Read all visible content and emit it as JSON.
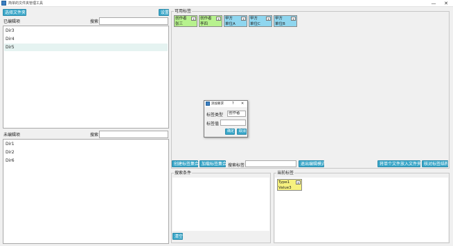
{
  "window": {
    "title": "简单的文件夹管理工具",
    "minimize": "—",
    "close": "✕"
  },
  "left": {
    "select_folder": "选择文件夹",
    "settings": "设置",
    "indexed_label": "已编辑项",
    "search_label": "搜索",
    "indexed_items": [
      "Dir3",
      "Dir4",
      "Dir5"
    ],
    "selected_index": 2,
    "unindexed_label": "未编辑项",
    "unindexed_search_label": "搜索",
    "unindexed_items": [
      "Dir1",
      "Dir2",
      "Dir6"
    ]
  },
  "tags_area": {
    "title": "可用标签",
    "tags": [
      {
        "type": "创作者",
        "value": "张三",
        "color": "green"
      },
      {
        "type": "创作者",
        "value": "李四",
        "color": "green"
      },
      {
        "type": "甲方",
        "value": "单位A",
        "color": "blue"
      },
      {
        "type": "甲方",
        "value": "单位C",
        "color": "blue"
      },
      {
        "type": "甲方",
        "value": "单位B",
        "color": "blue"
      }
    ],
    "close_glyph": "x"
  },
  "dialog": {
    "title": "添加要求",
    "help": "?",
    "close": "✕",
    "type_label": "标签类型",
    "type_value": "创作者",
    "value_label": "标签值",
    "value_value": "",
    "ok": "确定",
    "cancel": "取消"
  },
  "toolbar": {
    "create_set": "创建标签集合",
    "add_set": "加载标签集合",
    "search_label": "搜索标签",
    "search_value": "",
    "exit_edit": "退出编辑模式",
    "add_to_folder": "将单个文件放入文件夹",
    "check_structure": "核对标签结构"
  },
  "search_conditions": {
    "title": "搜索条件",
    "clear": "清空"
  },
  "current_tags": {
    "title": "当前标签",
    "tags": [
      {
        "type": "Type1",
        "value": "Value3",
        "color": "yellow"
      }
    ]
  },
  "colors": {
    "accent": "#3aa7c9",
    "green_tag": "#b7f28e",
    "blue_tag": "#8fd6ef",
    "yellow_tag": "#f6f17f"
  }
}
